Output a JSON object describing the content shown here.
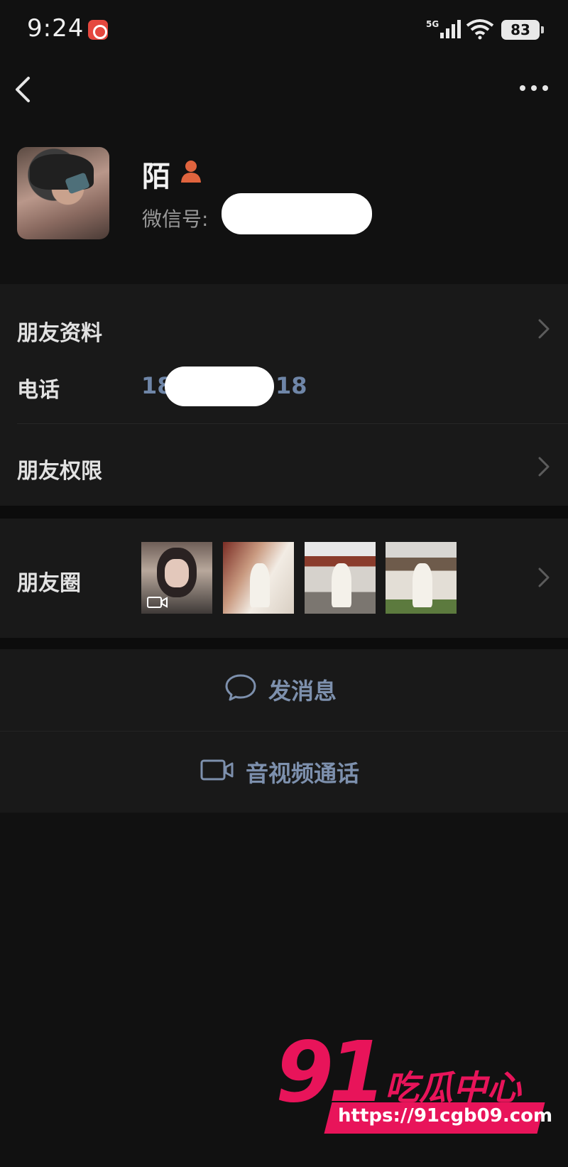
{
  "status_bar": {
    "time": "9:24",
    "network": "5G",
    "battery": "83"
  },
  "header": {
    "back_icon": "chevron-left-icon",
    "more_icon": "more-dots-icon"
  },
  "profile": {
    "name": "陌",
    "gender_icon": "person-icon",
    "wechat_id_label": "微信号:"
  },
  "rows": {
    "friend_info": "朋友资料",
    "phone_label": "电话",
    "phone_prefix": "18",
    "phone_suffix": "18",
    "friend_permissions": "朋友权限",
    "moments": "朋友圈"
  },
  "actions": {
    "send_message": "发消息",
    "video_call": "音视频通话"
  },
  "watermark": {
    "brand": "91",
    "brand_cn": "吃瓜中心",
    "url": "https://91cgb09.com"
  },
  "colors": {
    "background": "#111111",
    "row_background": "#191919",
    "link_blue": "#7d90ad",
    "watermark_pink": "#e8145a",
    "gender_icon": "#e0643e"
  }
}
